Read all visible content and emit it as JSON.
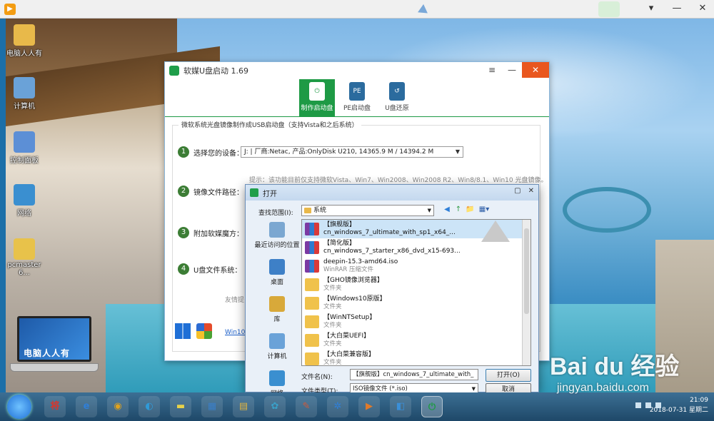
{
  "desktop": {
    "icons": [
      {
        "label": "电脑人人有",
        "icon": "user-folder-icon",
        "color": "#e8b94a"
      },
      {
        "label": "计算机",
        "icon": "computer-icon",
        "color": "#6aa2d8"
      },
      {
        "label": "控制面板",
        "icon": "control-panel-icon",
        "color": "#5c8fd6"
      },
      {
        "label": "网络",
        "icon": "network-globe-icon",
        "color": "#3a8fd0"
      },
      {
        "label": "pcmaster 6...",
        "icon": "folder-icon",
        "color": "#e8c24a"
      }
    ],
    "laptop_text": "电脑人人有"
  },
  "app": {
    "title": "软媒U盘启动 1.69",
    "window_controls": [
      "≡",
      "—",
      "✕"
    ],
    "tabs": [
      {
        "label": "制作启动盘",
        "active": true,
        "icon": "usb-power-icon",
        "glyph": "⏻"
      },
      {
        "label": "PE启动盘",
        "active": false,
        "icon": "usb-pe-icon",
        "glyph": "PE"
      },
      {
        "label": "U盘还原",
        "active": false,
        "icon": "usb-restore-icon",
        "glyph": "↺"
      }
    ],
    "panel_legend": "微软系统光盘镜像制作成USB启动盘（支持Vista和之后系统）",
    "steps": [
      {
        "num": "1",
        "label": "选择您的设备："
      },
      {
        "num": "2",
        "label": "镜像文件路径："
      },
      {
        "num": "3",
        "label": "附加软媒魔方："
      },
      {
        "num": "4",
        "label": "U盘文件系统："
      }
    ],
    "device_value": "J: | 厂商:Netac, 产品:OnlyDisk U210,  14365.9 M / 14394.2 M",
    "hint": "提示：该功能目前仅支持微软Vista、Win7、Win2008、Win2008 R2、Win8/8.1、Win10 光盘镜像。",
    "good_tip": "友情提",
    "win10_link": "Win10/"
  },
  "dialog": {
    "title": "打开",
    "controls": [
      "▢",
      "✕"
    ],
    "look_in_label": "查找范围(I):",
    "look_in_value": "系统",
    "nav_icons": [
      "◀",
      "↑",
      "📁",
      "▦▾"
    ],
    "places": [
      {
        "label": "最近访问的位置",
        "icon": "recent-places-icon",
        "color": "#7ba7d1"
      },
      {
        "label": "桌面",
        "icon": "desktop-icon",
        "color": "#3e80c7"
      },
      {
        "label": "库",
        "icon": "library-icon",
        "color": "#d8a93a"
      },
      {
        "label": "计算机",
        "icon": "computer-icon",
        "color": "#6aa2d8"
      },
      {
        "label": "网络",
        "icon": "network-globe-icon",
        "color": "#3a8fd0"
      }
    ],
    "files": [
      {
        "name": "【旗舰版】",
        "sub": "cn_windows_7_ultimate_with_sp1_x64_...",
        "kind": "rar",
        "selected": true
      },
      {
        "name": "【简化版】",
        "sub": "cn_windows_7_starter_x86_dvd_x15-693...",
        "kind": "rar",
        "selected": false
      },
      {
        "name": "deepin-15.3-amd64.iso",
        "sub": "WinRAR 压缩文件",
        "kind": "rar",
        "selected": false
      },
      {
        "name": "【GHO镜像浏览器】",
        "sub": "文件夹",
        "kind": "folder",
        "selected": false
      },
      {
        "name": "【Windows10原版】",
        "sub": "文件夹",
        "kind": "folder",
        "selected": false
      },
      {
        "name": "【WinNTSetup】",
        "sub": "文件夹",
        "kind": "folder",
        "selected": false
      },
      {
        "name": "【大白菜UEFI】",
        "sub": "文件夹",
        "kind": "folder",
        "selected": false
      },
      {
        "name": "【大白菜兼容版】",
        "sub": "文件夹",
        "kind": "folder",
        "selected": false
      }
    ],
    "filename_label": "文件名(N):",
    "filename_value": "【旗舰版】cn_windows_7_ultimate_with_",
    "filetype_label": "文件类型(T):",
    "filetype_value": "ISO镜像文件 (*.iso)",
    "open_button": "打开(O)",
    "cancel_button": "取消"
  },
  "taskbar": {
    "items": [
      {
        "icon": "pinyin-ime-icon",
        "glyph": "将",
        "color": "#d9352b"
      },
      {
        "icon": "ie-browser-icon",
        "glyph": "e",
        "color": "#2f7fd8"
      },
      {
        "icon": "chrome-icon",
        "glyph": "◉",
        "color": "#e0a21c"
      },
      {
        "icon": "search-bubble-icon",
        "glyph": "◐",
        "color": "#2f9ad8"
      },
      {
        "icon": "sticky-notes-icon",
        "glyph": "▬",
        "color": "#e8d24a"
      },
      {
        "icon": "remote-desktop-icon",
        "glyph": "▦",
        "color": "#3a7fc8"
      },
      {
        "icon": "explorer-folder-icon",
        "glyph": "▤",
        "color": "#e0b440"
      },
      {
        "icon": "recycle-tool-icon",
        "glyph": "✿",
        "color": "#3aa0c8"
      },
      {
        "icon": "paint-icon",
        "glyph": "✎",
        "color": "#d05a3a"
      },
      {
        "icon": "network-tool-icon",
        "glyph": "✲",
        "color": "#2f7fd8"
      },
      {
        "icon": "media-player-icon",
        "glyph": "▶",
        "color": "#e07a2a"
      },
      {
        "icon": "disk-tool-icon",
        "glyph": "◧",
        "color": "#3a8fd8"
      },
      {
        "icon": "usb-boot-app-icon",
        "glyph": "⏻",
        "color": "#1e9a45"
      }
    ],
    "time": "21:09",
    "date": "2018-07-31 星期二"
  },
  "watermark": {
    "logo": "Bai du 经验",
    "url": "jingyan.baidu.com"
  }
}
